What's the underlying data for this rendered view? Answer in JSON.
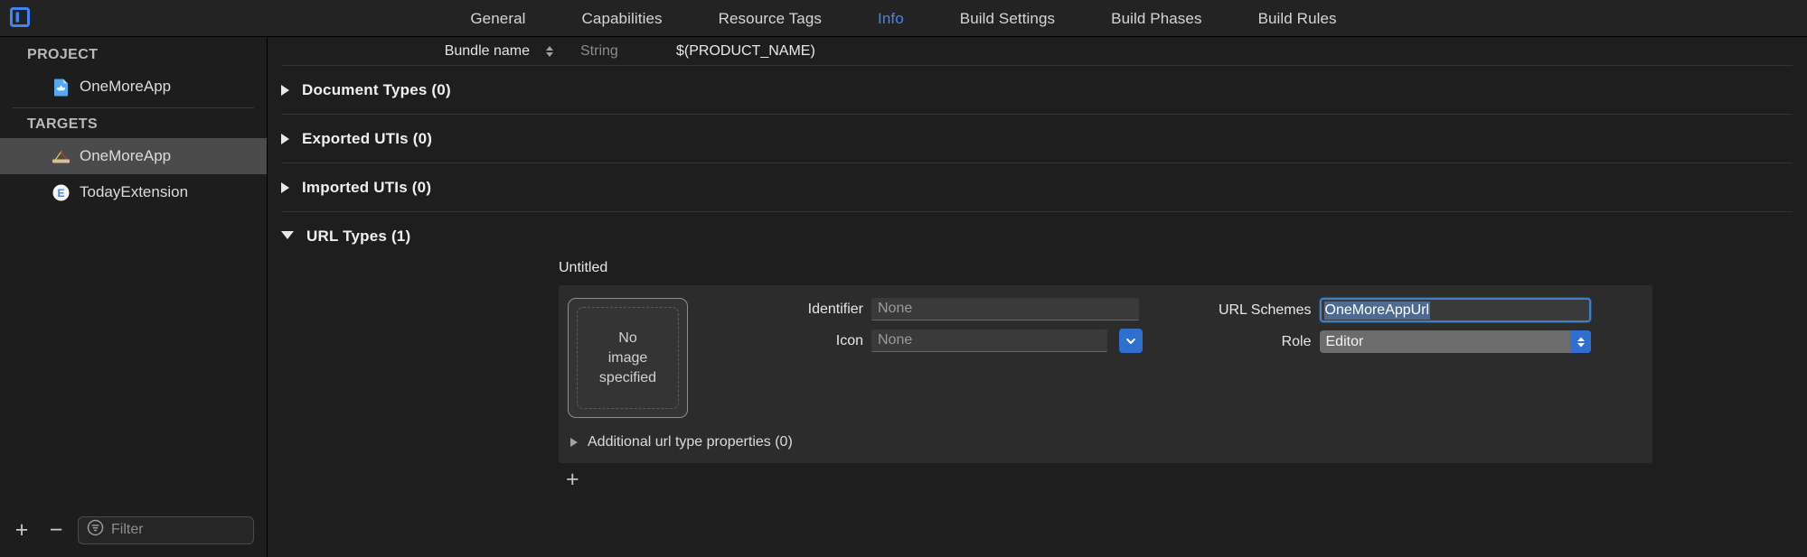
{
  "window": {
    "sidebar_toggle_icon": "sidebar-panel-icon"
  },
  "tabbar": {
    "tabs": [
      {
        "label": "General",
        "active": false
      },
      {
        "label": "Capabilities",
        "active": false
      },
      {
        "label": "Resource Tags",
        "active": false
      },
      {
        "label": "Info",
        "active": true
      },
      {
        "label": "Build Settings",
        "active": false
      },
      {
        "label": "Build Phases",
        "active": false
      },
      {
        "label": "Build Rules",
        "active": false
      }
    ]
  },
  "sidebar": {
    "project_header": "PROJECT",
    "project_items": [
      {
        "label": "OneMoreApp",
        "icon": "xcode-project-file-icon",
        "selected": false
      }
    ],
    "targets_header": "TARGETS",
    "target_items": [
      {
        "label": "OneMoreApp",
        "icon": "app-target-icon",
        "selected": true
      },
      {
        "label": "TodayExtension",
        "icon": "extension-target-icon",
        "selected": false
      }
    ],
    "bottom": {
      "add_label": "+",
      "remove_label": "−",
      "filter_placeholder": "Filter",
      "filter_value": "",
      "filter_icon": "filter-icon"
    }
  },
  "main": {
    "bundle_row": {
      "key": "Bundle name",
      "type": "String",
      "value": "$(PRODUCT_NAME)",
      "stepper_icon": "sort-stepper-icon"
    },
    "sections": [
      {
        "title": "Document Types (0)",
        "expanded": false
      },
      {
        "title": "Exported UTIs (0)",
        "expanded": false
      },
      {
        "title": "Imported UTIs (0)",
        "expanded": false
      },
      {
        "title": "URL Types (1)",
        "expanded": true
      }
    ],
    "url_type": {
      "name": "Untitled",
      "image_well": {
        "line1": "No",
        "line2": "image",
        "line3": "specified"
      },
      "identifier": {
        "label": "Identifier",
        "value": "",
        "placeholder": "None"
      },
      "icon": {
        "label": "Icon",
        "value": "",
        "placeholder": "None",
        "dropdown_icon": "chevron-down-icon"
      },
      "url_schemes": {
        "label": "URL Schemes",
        "value": "OneMoreAppUrl",
        "selected": true
      },
      "role": {
        "label": "Role",
        "value": "Editor",
        "stepper_icon": "popup-stepper-icon"
      },
      "additional": {
        "label": "Additional url type properties (0)",
        "expanded": false
      },
      "add_button": "+"
    }
  },
  "colors": {
    "accent_blue": "#3f86f5",
    "focus_border": "#3f7fc4",
    "selection_blue": "#4e6a8e",
    "combo_blue": "#2f6fd0",
    "row_selected": "#4b4b4b",
    "background": "#1e1e1e",
    "sidebar_bg": "#1d1d1d",
    "card_bg": "#2c2c2c"
  }
}
